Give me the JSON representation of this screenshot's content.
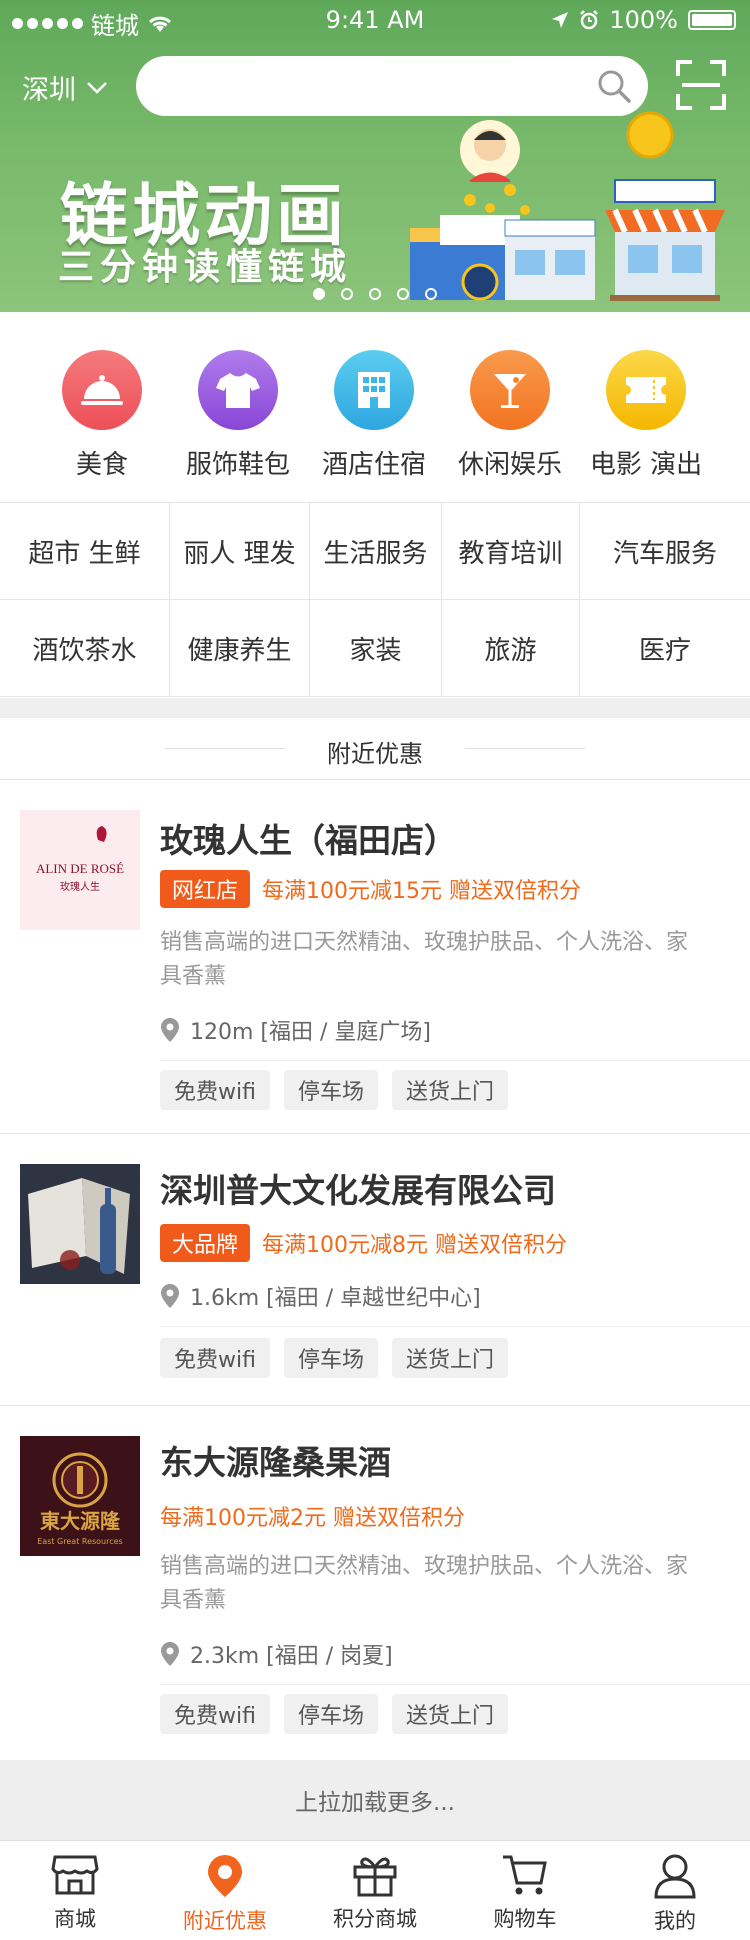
{
  "status": {
    "carrier": "链城",
    "time": "9:41 AM",
    "battery": "100%"
  },
  "header": {
    "city": "深圳",
    "search_placeholder": ""
  },
  "banner": {
    "title": "链城动画",
    "subtitle": "三分钟读懂链城",
    "pages": 5,
    "active_page": 1
  },
  "categories": [
    {
      "label": "美食",
      "icon": "cloche-icon",
      "color": "#f25a5e"
    },
    {
      "label": "服饰鞋包",
      "icon": "tshirt-icon",
      "color": "#9a5be0"
    },
    {
      "label": "酒店住宿",
      "icon": "building-icon",
      "color": "#3fb6e8"
    },
    {
      "label": "休闲娱乐",
      "icon": "cocktail-icon",
      "color": "#f5862e"
    },
    {
      "label": "电影 演出",
      "icon": "ticket-icon",
      "color": "#f7c51b"
    }
  ],
  "subcats_row1": [
    "超市 生鲜",
    "丽人 理发",
    "生活服务",
    "教育培训",
    "汽车服务"
  ],
  "subcats_row2": [
    "酒饮茶水",
    "健康养生",
    "家装",
    "旅游",
    "医疗"
  ],
  "section_title": "附近优惠",
  "stores": [
    {
      "name": "玫瑰人生（福田店）",
      "tag": "网红店",
      "promo": "每满100元减15元 赠送双倍积分",
      "desc": "销售高端的进口天然精油、玫瑰护肤品、个人洗浴、家具香薰",
      "location": "120m [福田 / 皇庭广场]",
      "features": [
        "免费wifi",
        "停车场",
        "送货上门"
      ],
      "thumb_text": "ALIN DE ROSÉ",
      "thumb_sub": "玫瑰人生"
    },
    {
      "name": "深圳普大文化发展有限公司",
      "tag": "大品牌",
      "promo": "每满100元减8元 赠送双倍积分",
      "desc": "",
      "location": "1.6km [福田 / 卓越世纪中心]",
      "features": [
        "免费wifi",
        "停车场",
        "送货上门"
      ]
    },
    {
      "name": "东大源隆桑果酒",
      "tag": "",
      "promo": "每满100元减2元 赠送双倍积分",
      "desc": "销售高端的进口天然精油、玫瑰护肤品、个人洗浴、家具香薰",
      "location": "2.3km [福田 / 岗夏]",
      "features": [
        "免费wifi",
        "停车场",
        "送货上门"
      ],
      "thumb_text": "東大源隆",
      "thumb_sub": "East Great Resources"
    }
  ],
  "load_more": "上拉加载更多...",
  "tabs": [
    {
      "label": "商城",
      "icon": "store-icon"
    },
    {
      "label": "附近优惠",
      "icon": "location-pin-icon",
      "active": true
    },
    {
      "label": "积分商城",
      "icon": "gift-icon"
    },
    {
      "label": "购物车",
      "icon": "cart-icon"
    },
    {
      "label": "我的",
      "icon": "user-icon"
    }
  ],
  "colors": {
    "accent": "#f0641e",
    "banner_green": "#78b96a",
    "tag_orange": "#f05a1a"
  }
}
